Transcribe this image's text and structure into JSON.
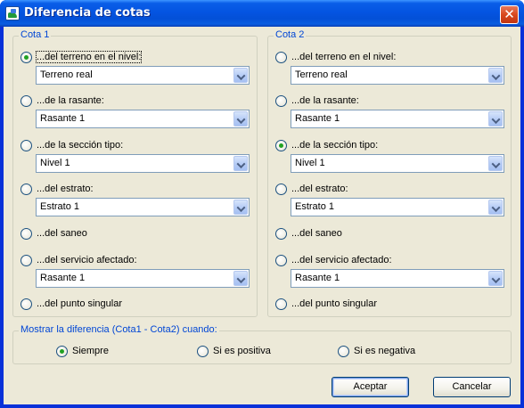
{
  "window": {
    "title": "Diferencia de cotas",
    "close_glyph": "✕"
  },
  "cota1": {
    "label": "Cota 1",
    "rows": [
      {
        "label": "...del terreno en el nivel:",
        "checked": true,
        "combo": "Terreno real"
      },
      {
        "label": "...de la rasante:",
        "checked": false,
        "combo": "Rasante 1"
      },
      {
        "label": "...de la sección tipo:",
        "checked": false,
        "combo": "Nivel 1"
      },
      {
        "label": "...del estrato:",
        "checked": false,
        "combo": "Estrato 1"
      },
      {
        "label": "...del saneo",
        "checked": false,
        "combo": null
      },
      {
        "label": "...del servicio afectado:",
        "checked": false,
        "combo": "Rasante 1"
      },
      {
        "label": "...del punto singular",
        "checked": false,
        "combo": null
      }
    ]
  },
  "cota2": {
    "label": "Cota 2",
    "rows": [
      {
        "label": "...del terreno en el nivel:",
        "checked": false,
        "combo": "Terreno real"
      },
      {
        "label": "...de la rasante:",
        "checked": false,
        "combo": "Rasante 1"
      },
      {
        "label": "...de la sección tipo:",
        "checked": true,
        "combo": "Nivel 1"
      },
      {
        "label": "...del estrato:",
        "checked": false,
        "combo": "Estrato 1"
      },
      {
        "label": "...del saneo",
        "checked": false,
        "combo": null
      },
      {
        "label": "...del servicio afectado:",
        "checked": false,
        "combo": "Rasante 1"
      },
      {
        "label": "...del punto singular",
        "checked": false,
        "combo": null
      }
    ]
  },
  "mostrar": {
    "label": "Mostrar la diferencia (Cota1 - Cota2) cuando:",
    "options": [
      {
        "label": "Siempre",
        "checked": true
      },
      {
        "label": "Si es positiva",
        "checked": false
      },
      {
        "label": "Si es negativa",
        "checked": false
      }
    ]
  },
  "buttons": {
    "accept": "Aceptar",
    "cancel": "Cancelar"
  }
}
